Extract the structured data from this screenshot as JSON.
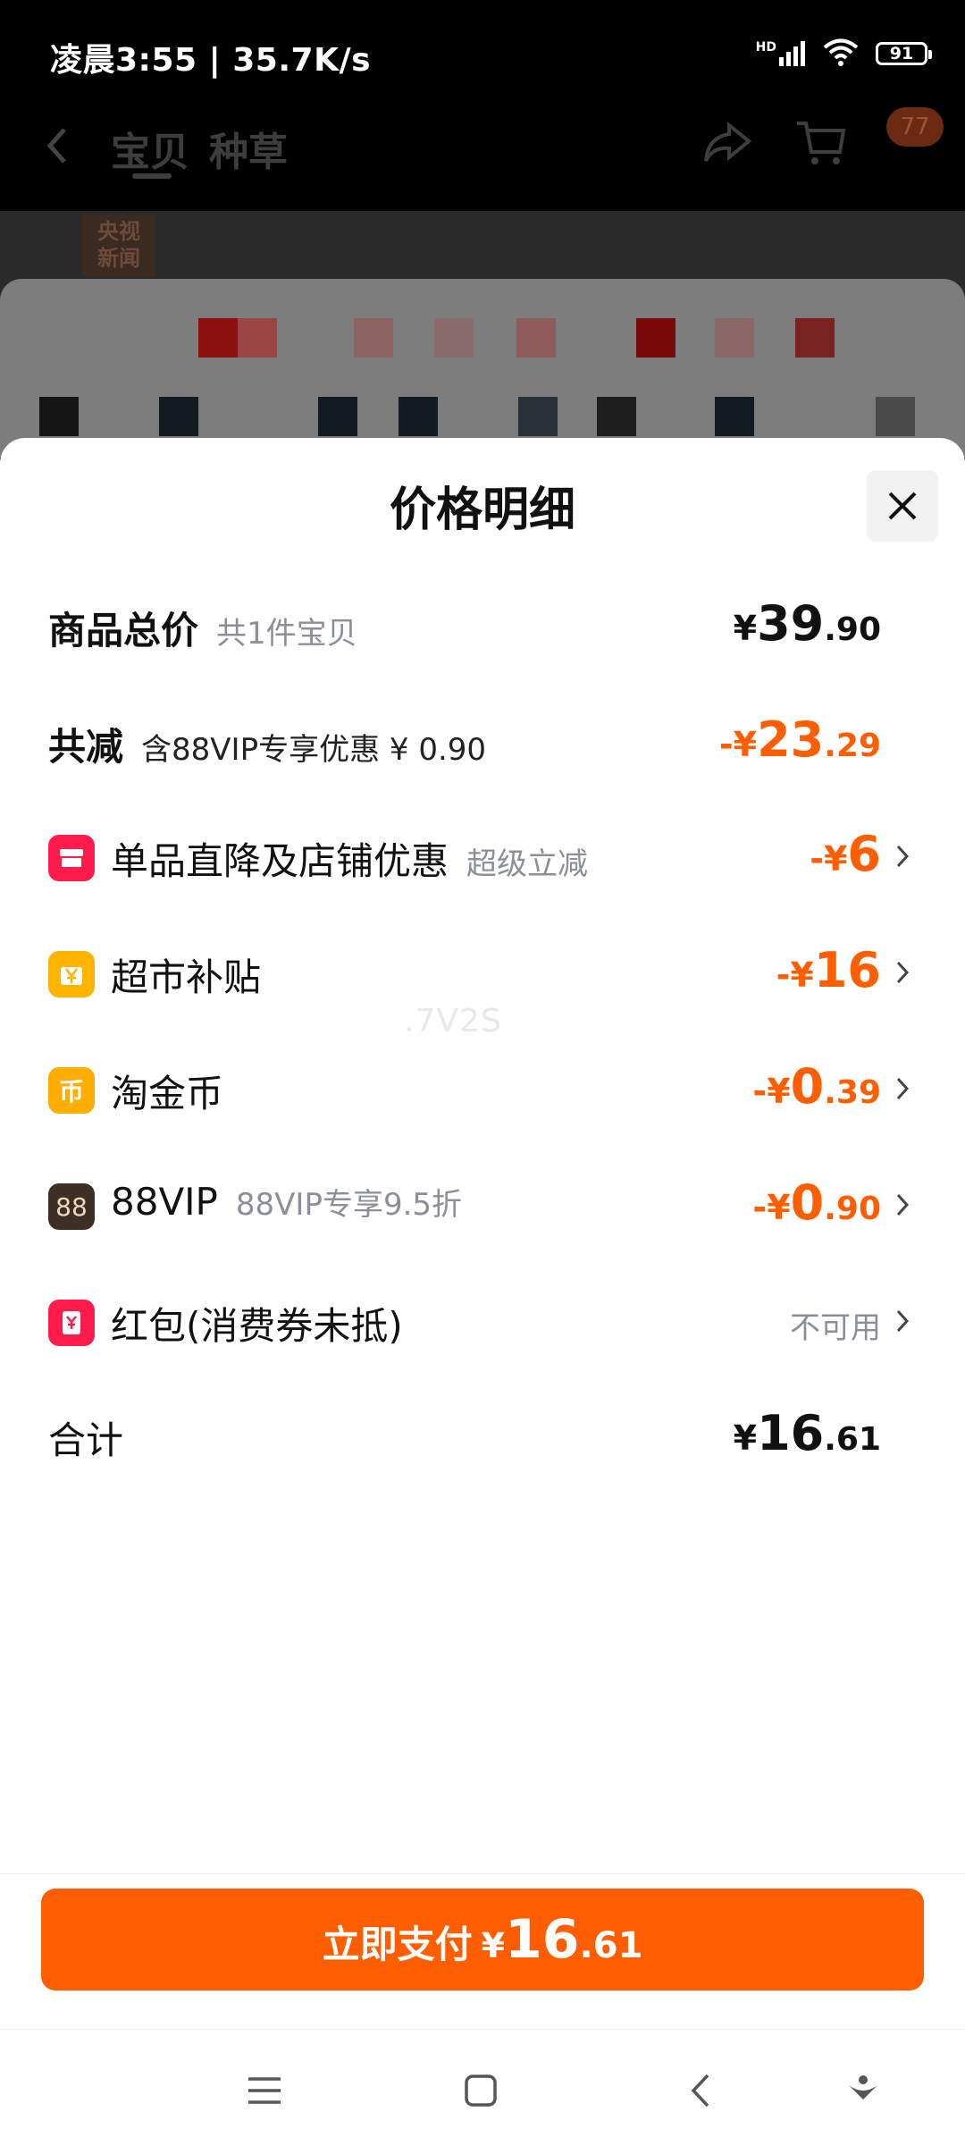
{
  "status_bar": {
    "time": "凌晨3:55 | 35.7K/s",
    "network_label": "HD",
    "battery": "91"
  },
  "background_page": {
    "tabs": [
      "宝贝",
      "种草"
    ],
    "cart_badge": "77",
    "image_logo_line1": "央视",
    "image_logo_line2": "新闻"
  },
  "sheet": {
    "title": "价格明细"
  },
  "rows": {
    "total_price": {
      "label": "商品总价",
      "sub": "共1件宝贝",
      "currency": "¥",
      "int": "39",
      "dec": ".90"
    },
    "total_discount": {
      "label": "共减",
      "sub": "含88VIP专享优惠 ¥ 0.90",
      "currency": "-¥",
      "int": "23",
      "dec": ".29"
    },
    "item_discount": {
      "label": "单品直降及店铺优惠",
      "sub": "超级立减",
      "currency": "-¥",
      "int": "6",
      "dec": ""
    },
    "supermarket": {
      "label": "超市补贴",
      "currency": "-¥",
      "int": "16",
      "dec": ""
    },
    "coins": {
      "label": "淘金币",
      "currency": "-¥",
      "int": "0",
      "dec": ".39"
    },
    "vip": {
      "label": "88VIP",
      "sub": "88VIP专享9.5折",
      "icon_text": "88",
      "currency": "-¥",
      "int": "0",
      "dec": ".90"
    },
    "red_packet": {
      "label": "红包(消费券未抵)",
      "status": "不可用"
    },
    "grand_total": {
      "label": "合计",
      "currency": "¥",
      "int": "16",
      "dec": ".61"
    }
  },
  "watermark": ".7V2S",
  "pay_button": {
    "label": "立即支付",
    "currency": "¥",
    "int": "16",
    "dec": ".61"
  },
  "colors": {
    "accent": "#ff5e00",
    "shop_icon": "#ff1c4a",
    "supermarket_icon": "#ffb400",
    "coin_icon": "#ffad00",
    "vip_icon": "#3b2f26",
    "red_packet_icon": "#ff1c4a"
  }
}
